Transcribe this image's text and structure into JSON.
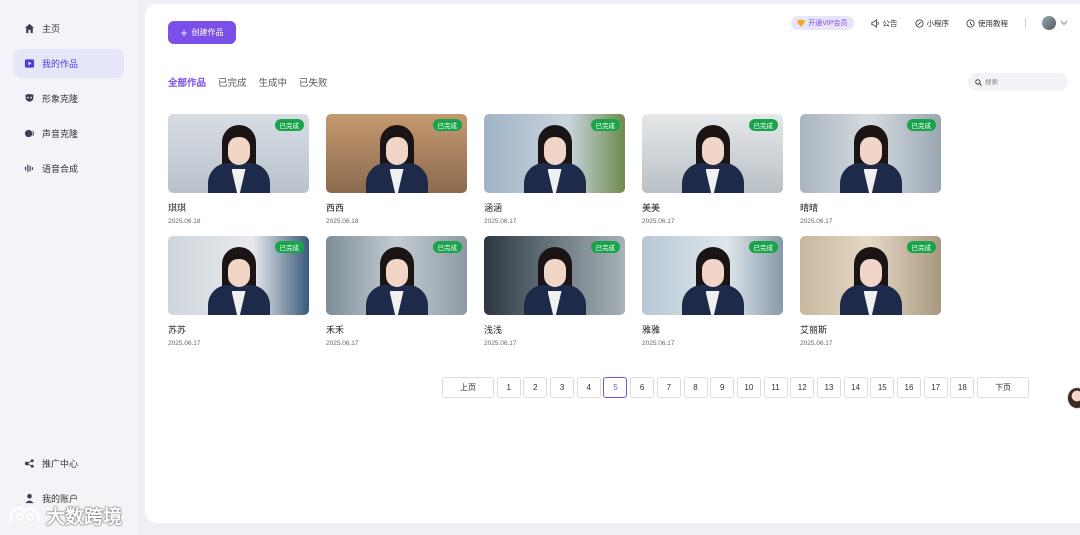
{
  "sidebar": {
    "items": [
      {
        "label": "主页",
        "icon": "home-icon",
        "active": false
      },
      {
        "label": "我的作品",
        "icon": "video-icon",
        "active": true
      },
      {
        "label": "形象克隆",
        "icon": "mask-icon",
        "active": false
      },
      {
        "label": "声音克隆",
        "icon": "voice-icon",
        "active": false
      },
      {
        "label": "语音合成",
        "icon": "waveform-icon",
        "active": false
      }
    ],
    "bottom": [
      {
        "label": "推广中心",
        "icon": "share-icon"
      },
      {
        "label": "我的账户",
        "icon": "user-icon"
      }
    ]
  },
  "create_button": {
    "label": "创建作品"
  },
  "topbar": {
    "vip": "开通VIP会员",
    "announce": "公告",
    "miniapp": "小程序",
    "tutorial": "使用教程"
  },
  "tabs": [
    "全部作品",
    "已完成",
    "生成中",
    "已失败"
  ],
  "search": {
    "placeholder": "搜索"
  },
  "cards": [
    {
      "title": "琪琪",
      "date": "2025.06.18",
      "status": "已完成"
    },
    {
      "title": "西西",
      "date": "2025.06.18",
      "status": "已完成"
    },
    {
      "title": "涵涵",
      "date": "2025.06.17",
      "status": "已完成"
    },
    {
      "title": "美美",
      "date": "2025.06.17",
      "status": "已完成"
    },
    {
      "title": "晴晴",
      "date": "2025.06.17",
      "status": "已完成"
    },
    {
      "title": "苏苏",
      "date": "2025.06.17",
      "status": "已完成"
    },
    {
      "title": "禾禾",
      "date": "2025.06.17",
      "status": "已完成"
    },
    {
      "title": "浅浅",
      "date": "2025.06.17",
      "status": "已完成"
    },
    {
      "title": "雅雅",
      "date": "2025.06.17",
      "status": "已完成"
    },
    {
      "title": "艾丽斯",
      "date": "2025.06.17",
      "status": "已完成"
    }
  ],
  "pagination": {
    "prev": "上页",
    "next": "下页",
    "pages": [
      "1",
      "2",
      "3",
      "4",
      "5",
      "6",
      "7",
      "8",
      "9",
      "10",
      "11",
      "12",
      "13",
      "14",
      "15",
      "16",
      "17",
      "18"
    ],
    "current": "5"
  },
  "watermark": "大数跨境",
  "colors": {
    "accent": "#7a4fea",
    "badge": "#19a34a"
  }
}
